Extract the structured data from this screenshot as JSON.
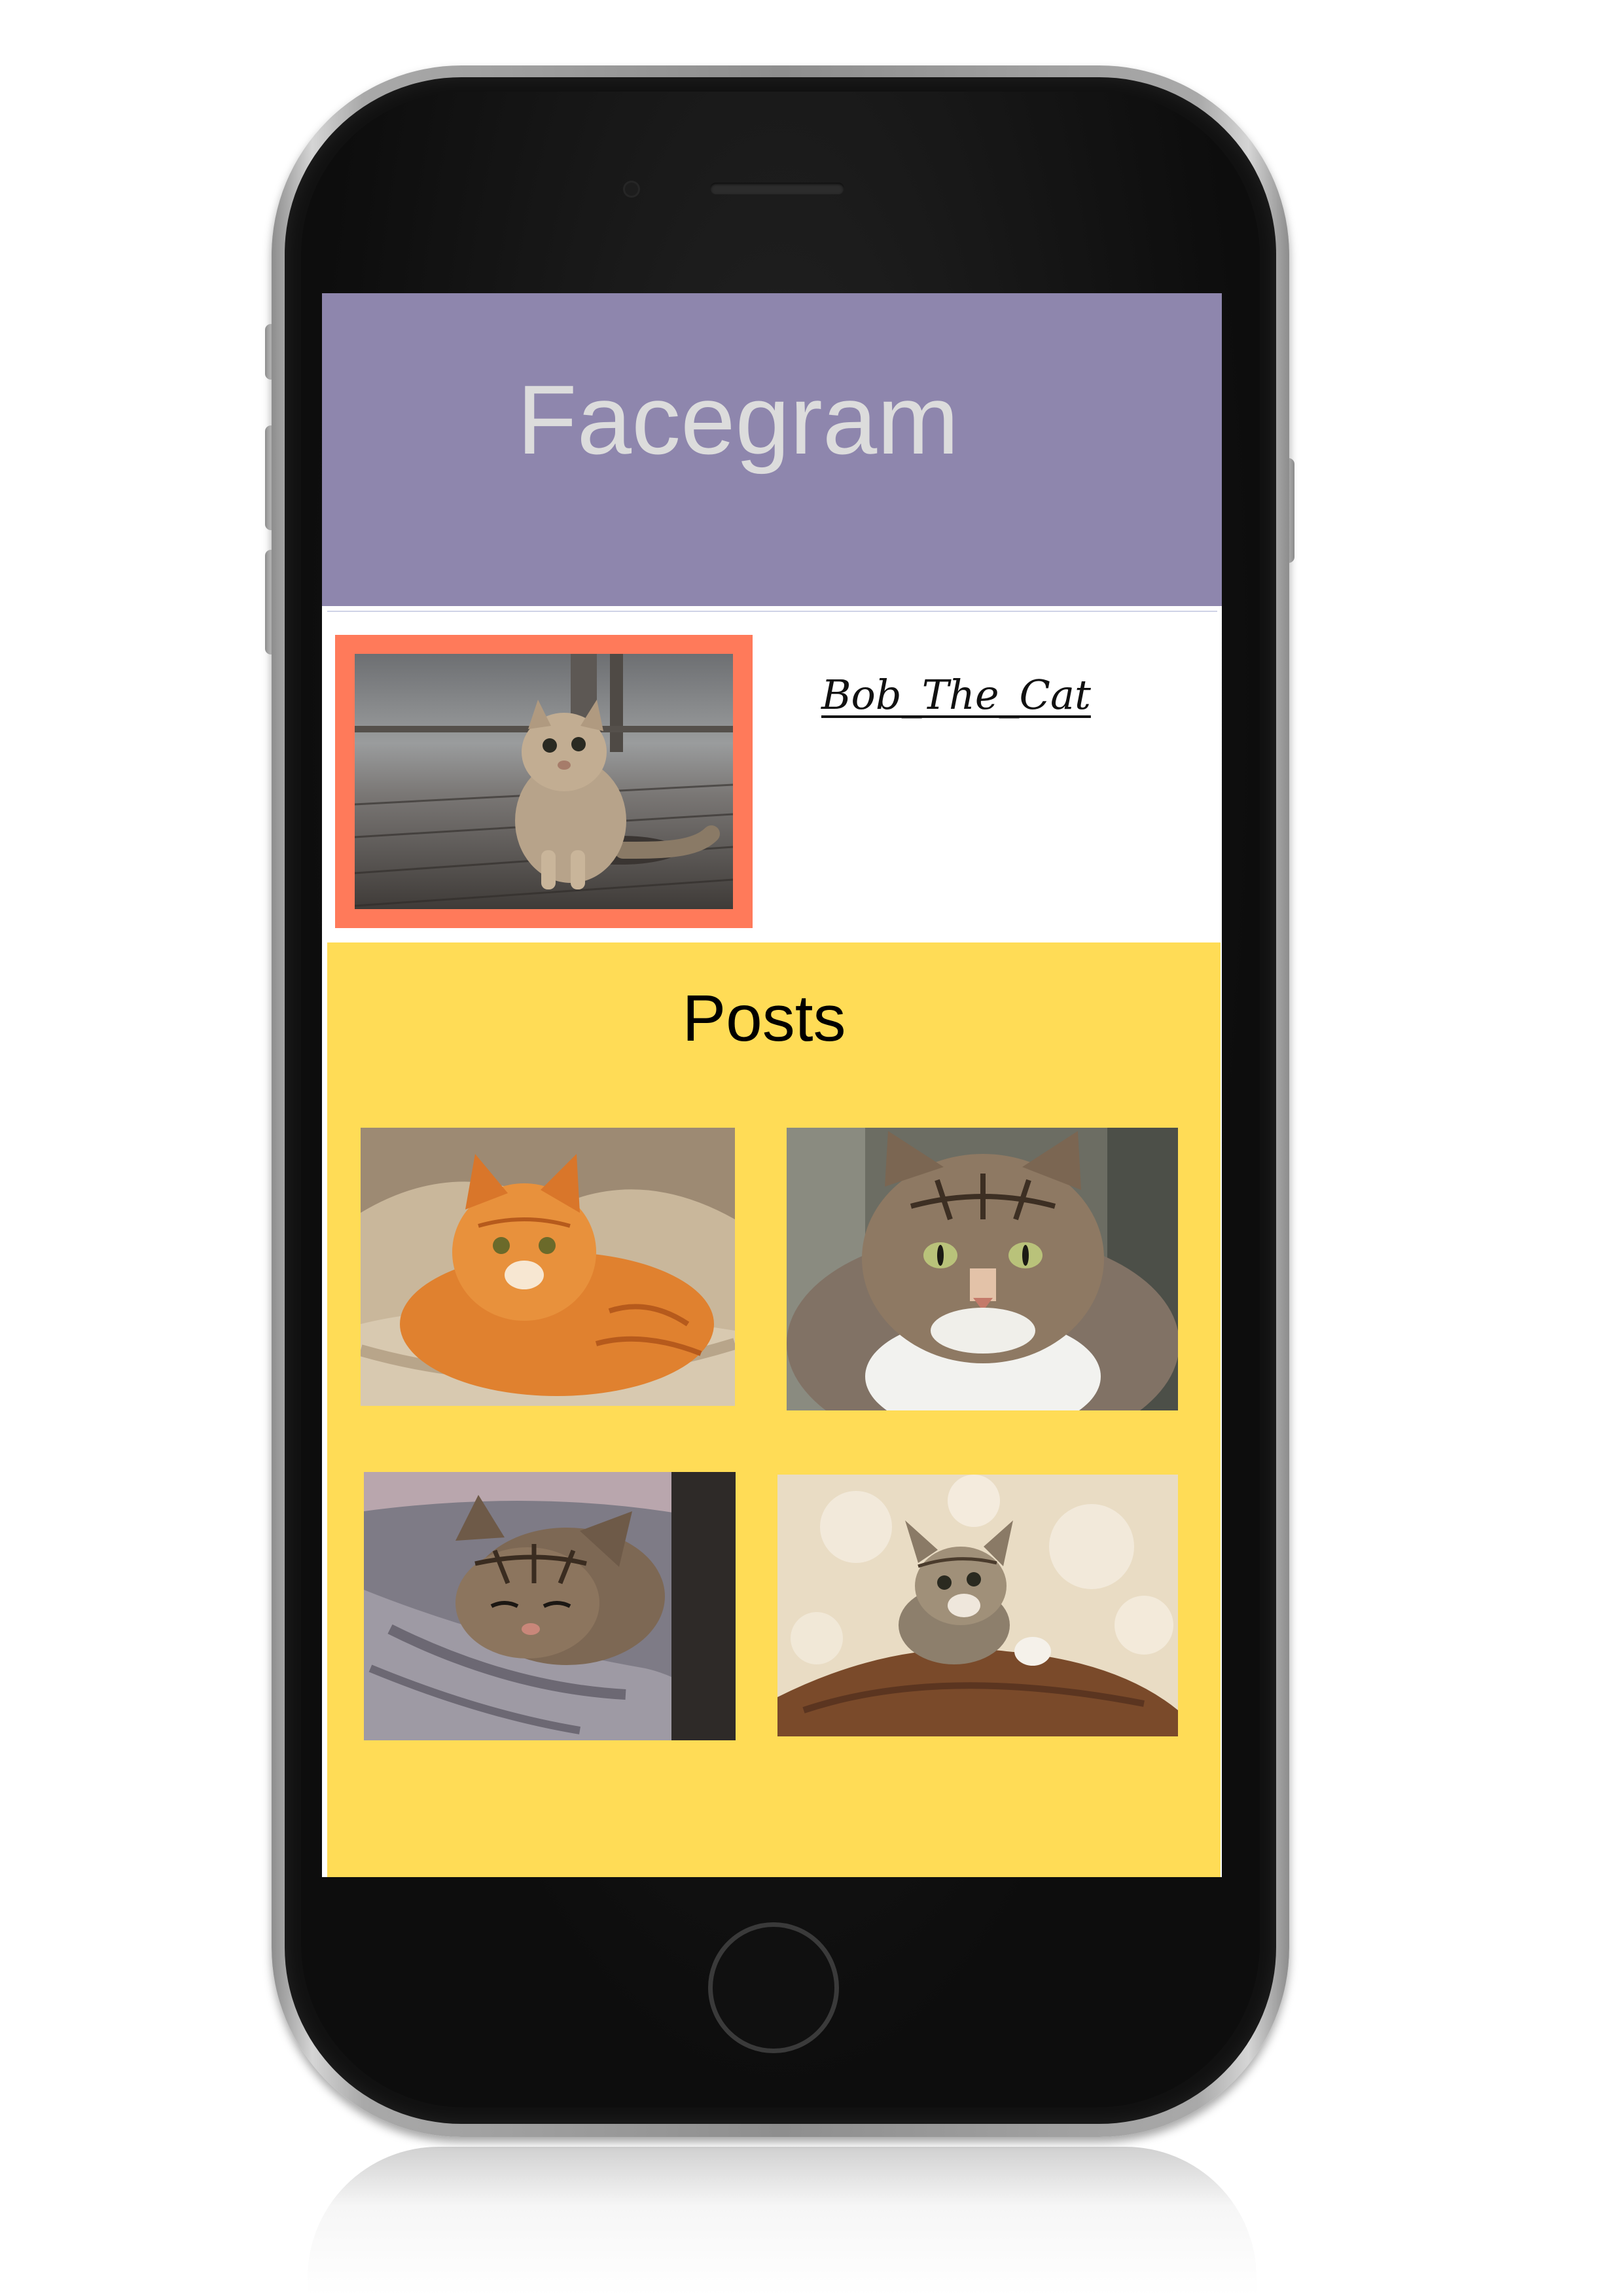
{
  "app": {
    "title": "Facegram"
  },
  "profile": {
    "username": "Bob_The_Cat"
  },
  "posts": {
    "heading": "Posts",
    "items": [
      {
        "icon": "orange-tabby-cat-photo"
      },
      {
        "icon": "tabby-white-cat-face-photo"
      },
      {
        "icon": "sleeping-tabby-kitten-photo"
      },
      {
        "icon": "kitten-looking-up-photo"
      }
    ]
  },
  "colors": {
    "header_bg": "#8e86ad",
    "title_text": "#dcdcdc",
    "avatar_frame": "#ff7a5a",
    "posts_bg": "#ffdc56"
  }
}
